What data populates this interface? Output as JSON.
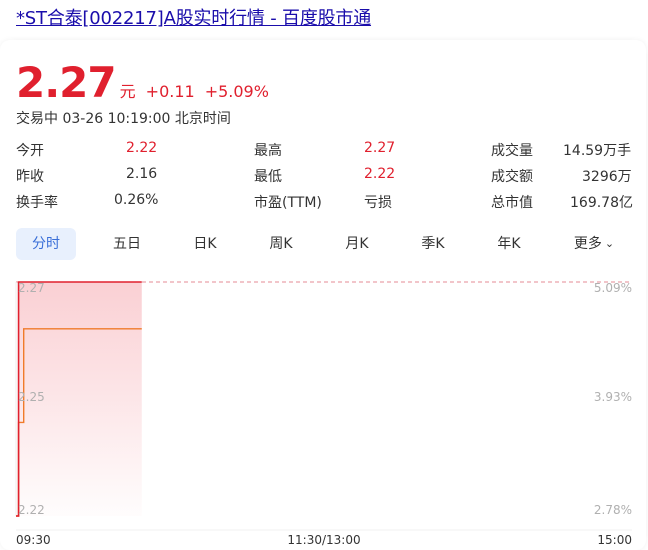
{
  "page": {
    "title_link": "*ST合泰[002217]A股实时行情 - 百度股市通"
  },
  "quote": {
    "price": "2.27",
    "unit": "元",
    "change": "+0.11",
    "change_pct": "+5.09%",
    "status_time": "交易中 03-26 10:19:00 北京时间"
  },
  "stats": {
    "rows": [
      [
        {
          "label": "今开",
          "value": "2.22"
        },
        {
          "label": "最高",
          "value": "2.27"
        },
        {
          "label": "成交量",
          "value": "14.59万手"
        }
      ],
      [
        {
          "label": "昨收",
          "value": "2.16"
        },
        {
          "label": "最低",
          "value": "2.22"
        },
        {
          "label": "成交额",
          "value": "3296万"
        }
      ],
      [
        {
          "label": "换手率",
          "value": "0.26%"
        },
        {
          "label": "市盈(TTM)",
          "value": "亏损"
        },
        {
          "label": "总市值",
          "value": "169.78亿"
        }
      ]
    ]
  },
  "tabs": [
    "分时",
    "五日",
    "日K",
    "周K",
    "月K",
    "季K",
    "年K",
    "更多"
  ],
  "active_tab": "分时",
  "colors": {
    "up": "#e0202e",
    "accent": "#3a6fd8",
    "avg_line": "#f07b2a"
  },
  "chart_data": {
    "type": "line",
    "x_ticks": [
      "09:30",
      "11:30/13:00",
      "15:00"
    ],
    "y_ticks_left": [
      "2.27",
      "2.25",
      "2.22"
    ],
    "y_ticks_right": [
      "5.09%",
      "3.93%",
      "2.78%"
    ],
    "ylim": [
      2.22,
      2.27
    ],
    "series": [
      {
        "name": "price",
        "x": [
          "09:30",
          "09:31",
          "09:32",
          "09:33",
          "10:19"
        ],
        "values": [
          2.22,
          2.27,
          2.27,
          2.27,
          2.27
        ]
      },
      {
        "name": "avg",
        "x": [
          "09:30",
          "09:31",
          "09:32",
          "09:33",
          "10:19"
        ],
        "values": [
          2.22,
          2.24,
          2.24,
          2.26,
          2.26
        ]
      }
    ]
  }
}
